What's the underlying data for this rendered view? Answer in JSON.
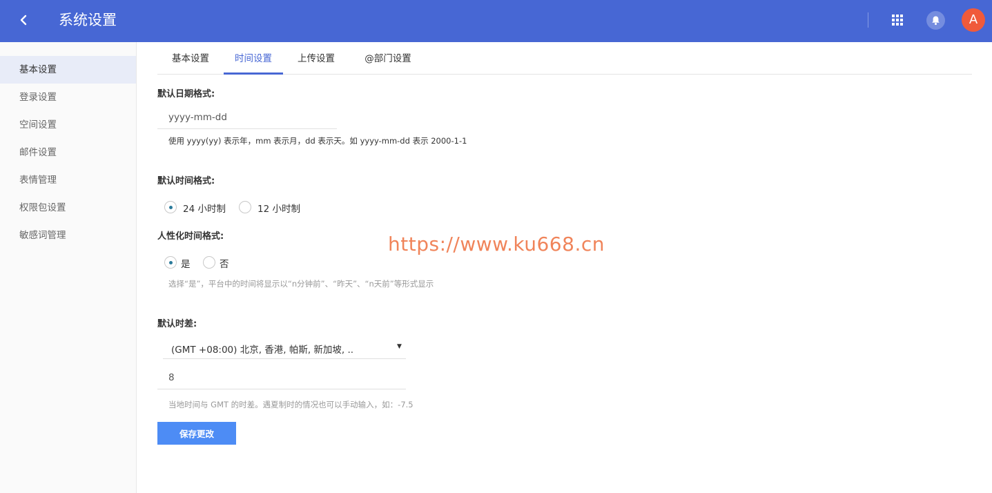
{
  "header": {
    "title": "系统设置",
    "avatar_letter": "A",
    "color": "#4767d4"
  },
  "sidebar": {
    "items": [
      {
        "label": "基本设置",
        "active": true
      },
      {
        "label": "登录设置"
      },
      {
        "label": "空间设置"
      },
      {
        "label": "邮件设置"
      },
      {
        "label": "表情管理"
      },
      {
        "label": "权限包设置"
      },
      {
        "label": "敏感词管理"
      }
    ]
  },
  "tabs": [
    {
      "label": "基本设置"
    },
    {
      "label": "时间设置",
      "active": true
    },
    {
      "label": "上传设置"
    },
    {
      "label": "@部门设置"
    }
  ],
  "date_format": {
    "label": "默认日期格式:",
    "value": "yyyy-mm-dd",
    "hint": "使用 yyyy(yy) 表示年，mm 表示月，dd 表示天。如 yyyy-mm-dd 表示 2000-1-1"
  },
  "time_format": {
    "label": "默认时间格式:",
    "options": [
      {
        "label": "24 小时制",
        "checked": true
      },
      {
        "label": "12 小时制",
        "checked": false
      }
    ]
  },
  "humanized": {
    "label": "人性化时间格式:",
    "options": [
      {
        "label": "是",
        "checked": true
      },
      {
        "label": "否",
        "checked": false
      }
    ],
    "hint": "选择“是”，平台中的时间将显示以“n分钟前”、“昨天”、“n天前”等形式显示"
  },
  "timezone": {
    "label": "默认时差:",
    "selected": "(GMT +08:00) 北京, 香港, 帕斯, 新加坡, ..",
    "offset_value": "8",
    "hint": "当地时间与 GMT 的时差。遇夏制时的情况也可以手动输入，如：-7.5"
  },
  "save_button": "保存更改",
  "watermark": "https://www.ku668.cn",
  "icons": {
    "back": "chevron-left-icon",
    "apps": "grid-icon",
    "notifications": "bell-icon"
  }
}
